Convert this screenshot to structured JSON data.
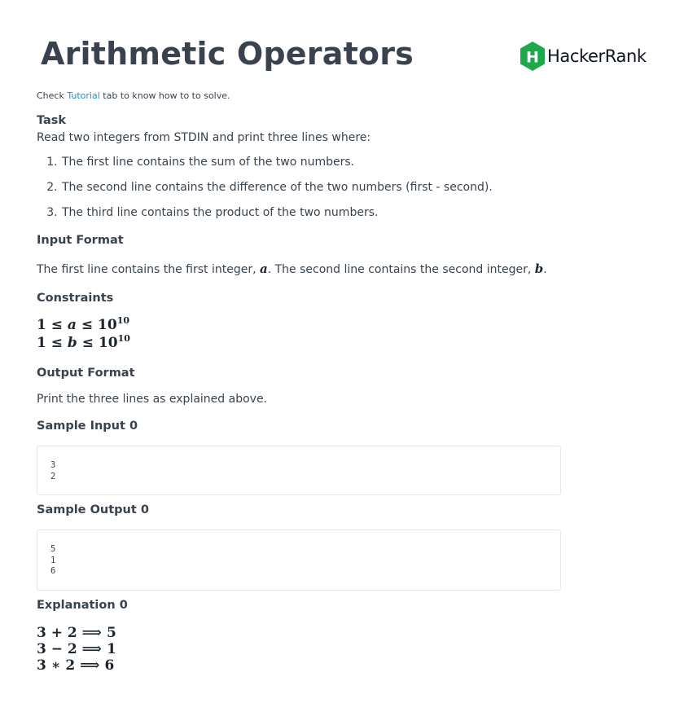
{
  "header": {
    "title": "Arithmetic Operators",
    "logo_text": "HackerRank",
    "logo_letter": "H",
    "brand_color": "#1ba94c"
  },
  "note": {
    "prefix": "Check",
    "link": "Tutorial",
    "suffix": "tab to know how to to solve."
  },
  "task": {
    "heading": "Task",
    "intro": "Read two integers from STDIN and print three lines where:",
    "items": [
      "The first line contains the sum of the two numbers.",
      "The second line contains the difference of the two numbers (first - second).",
      "The third line contains the product of the two numbers."
    ]
  },
  "input_format": {
    "heading": "Input Format",
    "text_before_a": "The first line contains the first integer,",
    "var_a": "a",
    "text_middle": ". The second line contains the second integer,",
    "var_b": "b",
    "text_end": "."
  },
  "constraints": {
    "heading": "Constraints",
    "lines": [
      {
        "left": "1 ≤",
        "var": "a",
        "right": "≤ 10",
        "exp": "10"
      },
      {
        "left": "1 ≤",
        "var": "b",
        "right": "≤ 10",
        "exp": "10"
      }
    ]
  },
  "output_format": {
    "heading": "Output Format",
    "text": "Print the three lines as explained above."
  },
  "sample_input": {
    "heading": "Sample Input 0",
    "lines": [
      "3",
      "2"
    ]
  },
  "sample_output": {
    "heading": "Sample Output 0",
    "lines": [
      "5",
      "1",
      "6"
    ]
  },
  "explanation": {
    "heading": "Explanation 0",
    "lines": [
      "3 + 2 ⟹ 5",
      "3 − 2 ⟹ 1",
      "3 ∗ 2 ⟹ 6"
    ]
  }
}
